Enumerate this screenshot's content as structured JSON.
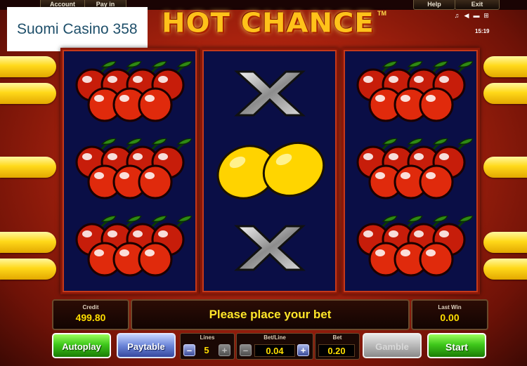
{
  "top_menu": {
    "account": "Account",
    "pay_in": "Pay in",
    "help": "Help",
    "exit": "Exit"
  },
  "clock": "15:19",
  "overlay_logo": "Suomi Casino 358",
  "game_title": "HOT CHANCE",
  "trademark": "TM",
  "reels": [
    [
      "cherries",
      "cherries",
      "cherries"
    ],
    [
      "x-symbol",
      "lemons",
      "x-symbol"
    ],
    [
      "cherries",
      "cherries",
      "cherries"
    ]
  ],
  "credit": {
    "label": "Credit",
    "value": "499.80"
  },
  "message": "Please place your bet",
  "last_win": {
    "label": "Last Win",
    "value": "0.00"
  },
  "buttons": {
    "autoplay": "Autoplay",
    "paytable": "Paytable",
    "gamble": "Gamble",
    "start": "Start"
  },
  "lines": {
    "label": "Lines",
    "value": "5"
  },
  "bet_line": {
    "label": "Bet/Line",
    "value": "0.04"
  },
  "bet": {
    "label": "Bet",
    "value": "0.20"
  },
  "colors": {
    "accent_yellow": "#ffde00",
    "reel_bg": "#0a0e46",
    "start_green": "#3fc81b",
    "paytable_blue": "#6b85d8"
  }
}
